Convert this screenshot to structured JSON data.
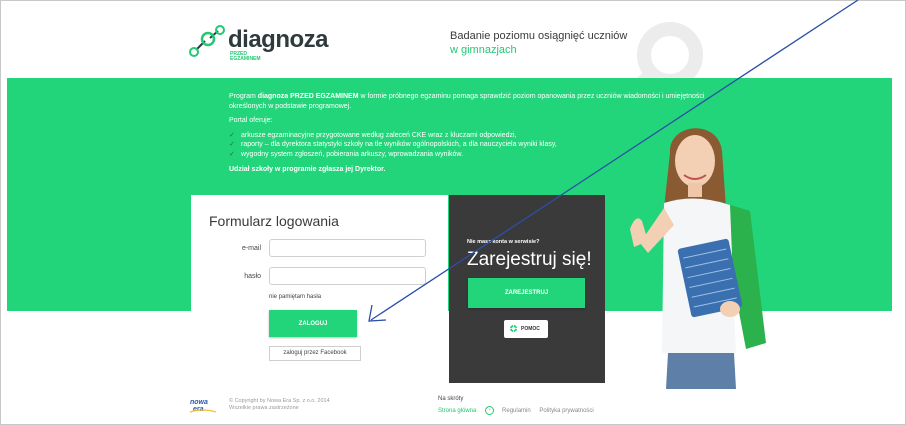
{
  "header": {
    "logo_text": "diagnoza",
    "logo_sub_line1": "PRZED",
    "logo_sub_line2": "EGZAMINEM",
    "tagline_line1": "Badanie poziomu osiągnięć uczniów",
    "tagline_line2": "w gimnazjach"
  },
  "intro": {
    "p1_prefix": "Program ",
    "p1_bold": "diagnoza PRZED EGZAMINEM",
    "p1_rest": " w formie próbnego egzaminu pomaga sprawdzić poziom opanowania przez uczniów wiadomości i umiejętności określonych w podstawie programowej.",
    "portal_label": "Portal oferuje:",
    "features": [
      "arkusze egzaminacyjne przygotowane według zaleceń CKE wraz z kluczami odpowiedzi,",
      "raporty – dla dyrektora statystyki szkoły na tle wyników ogólnopolskich, a dla nauczyciela wyniki klasy,",
      "wygodny system zgłoszeń, pobierania arkuszy, wprowadzania wyników."
    ],
    "note": "Udział szkoły w programie zgłasza jej Dyrektor."
  },
  "login": {
    "title": "Formularz logowania",
    "email_label": "e-mail",
    "email_value": "",
    "password_label": "hasło",
    "password_value": "",
    "forgot_label": "nie pamiętam hasła",
    "submit_label": "ZALOGUJ",
    "facebook_label": "zaloguj przez Facebook"
  },
  "register": {
    "question": "Nie masz konta w serwisie?",
    "heading": "Zarejestruj się!",
    "button_label": "ZAREJESTRUJ",
    "help_label": "POMOC"
  },
  "footer": {
    "logo_top": "nowa",
    "logo_bottom": "era",
    "copyright_line1": "© Copyright by Nowa Era Sp. z o.o. 2014",
    "copyright_line2": "Wszelkie prawa zastrzeżone",
    "nav_title": "Na skróty",
    "nav_home": "Strona główna",
    "nav_rules": "Regulamin",
    "nav_privacy": "Polityka prywatności"
  },
  "colors": {
    "accent": "#22d57a",
    "dark_panel": "#3a3a3a",
    "arrow": "#2b4fa8"
  },
  "icons": [
    "molecule-logo-icon",
    "check-icon",
    "help-lifebuoy-icon",
    "arrow-annotation"
  ]
}
